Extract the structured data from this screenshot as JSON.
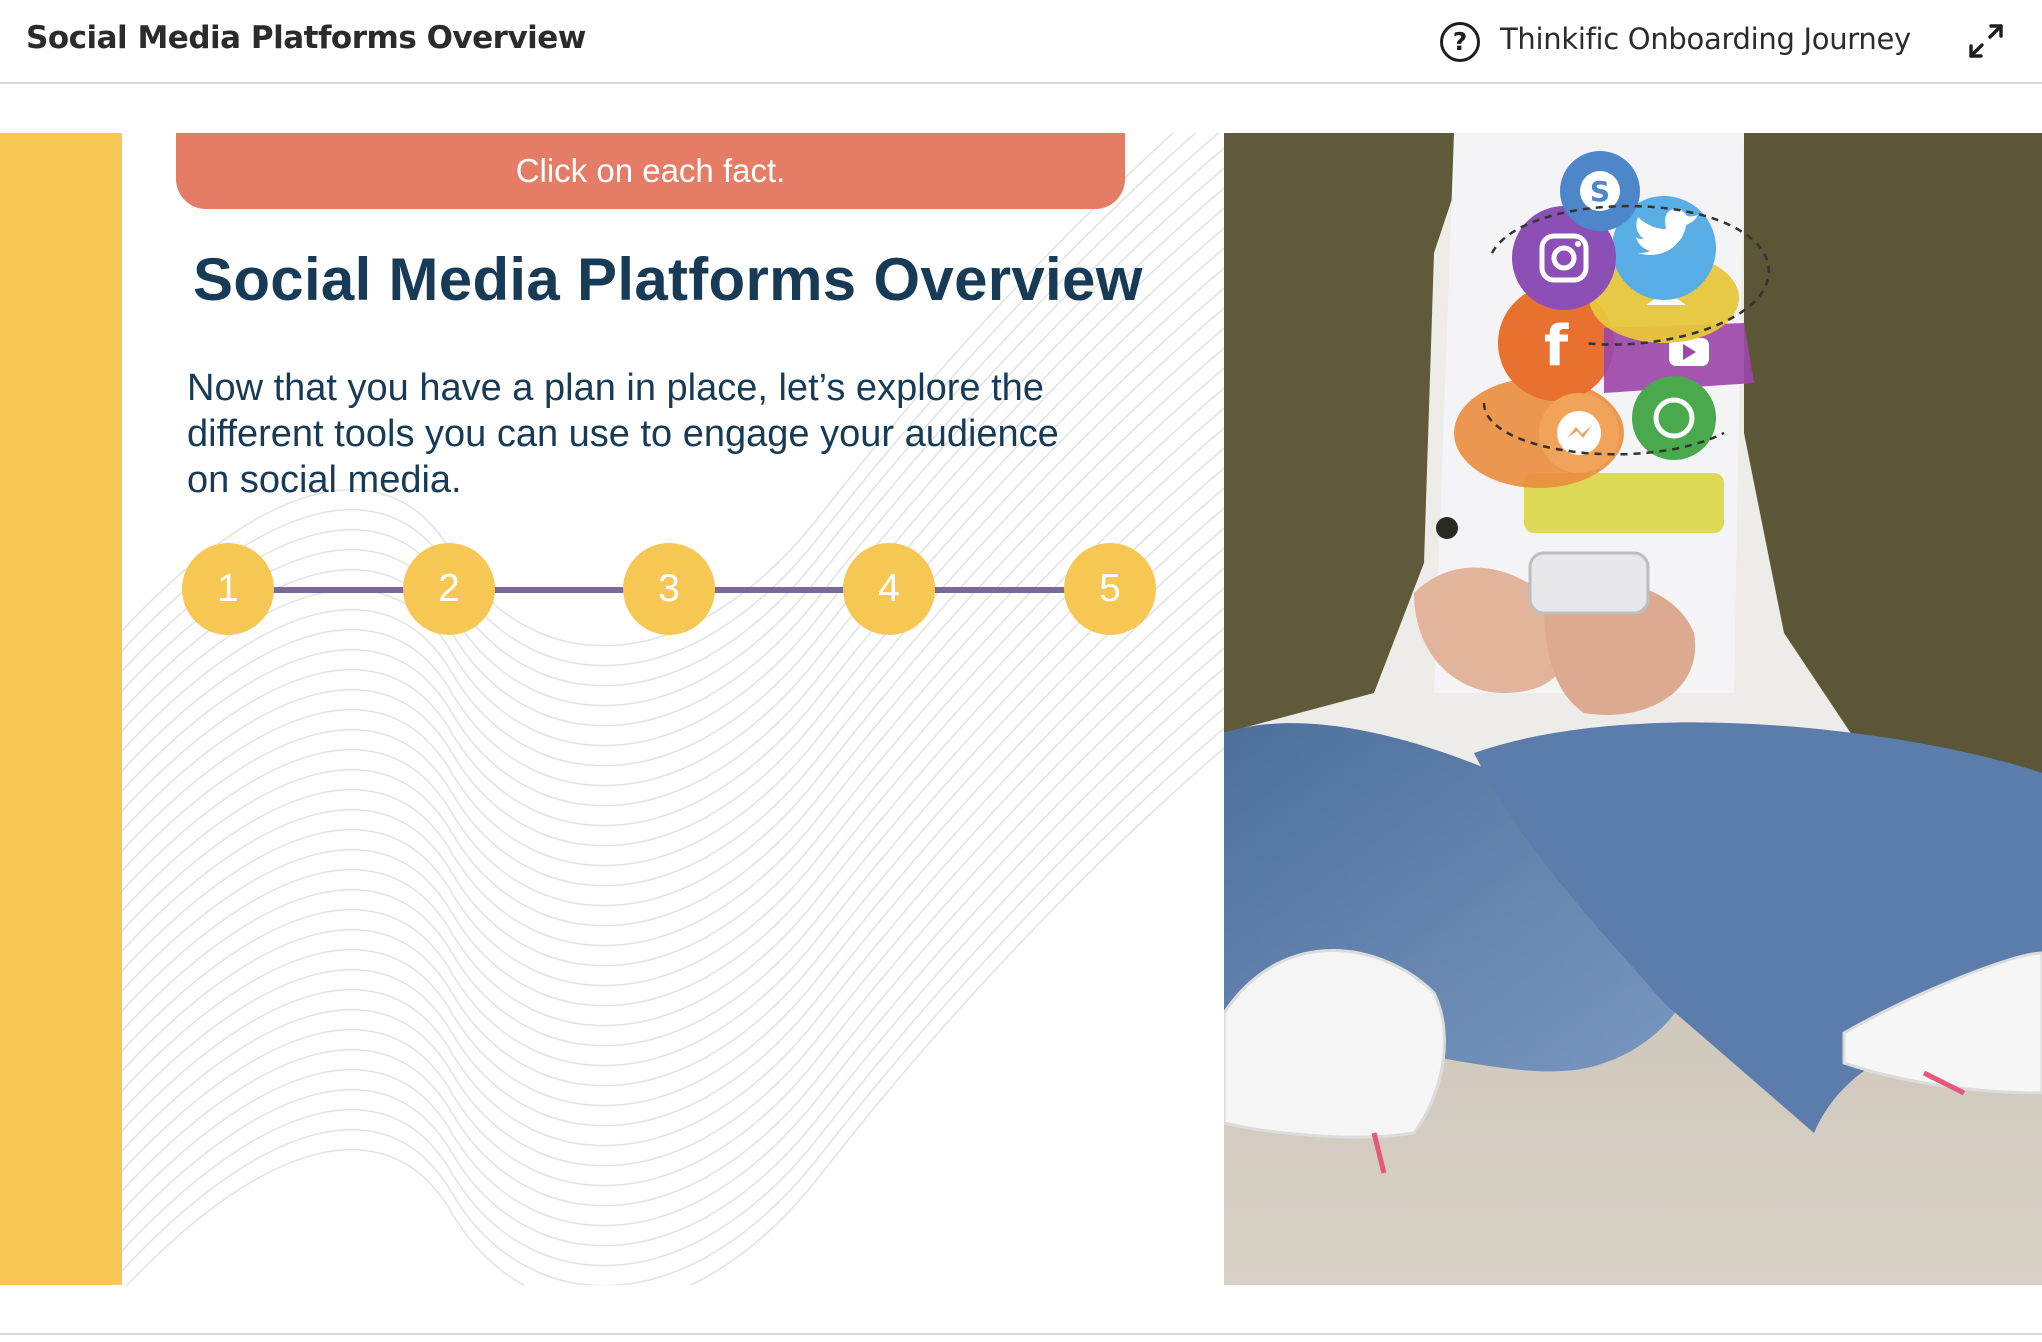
{
  "header": {
    "title": "Social Media Platforms Overview",
    "course_name": "Thinkific Onboarding Journey",
    "help_icon": "question-circle-icon",
    "help_glyph": "?",
    "expand_icon": "expand-arrows-icon"
  },
  "slide": {
    "banner": "Click on each fact.",
    "title": "Social Media Platforms Overview",
    "intro": "Now that you have a plan in place, let’s explore the different tools you can use to engage your audience on social media.",
    "steps": [
      "1",
      "2",
      "3",
      "4",
      "5"
    ],
    "photo": {
      "icons": [
        "skype-icon",
        "twitter-icon",
        "instagram-icon",
        "snapchat-icon",
        "facebook-icon",
        "youtube-icon",
        "messenger-icon",
        "whatsapp-icon"
      ]
    }
  },
  "colors": {
    "accent_yellow": "#f6c753",
    "banner_coral": "#e57c66",
    "title_navy": "#173a57",
    "timeline_line": "#77699a"
  }
}
